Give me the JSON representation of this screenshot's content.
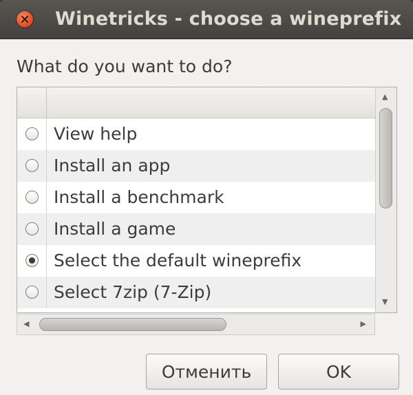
{
  "window": {
    "title": "Winetricks - choose a wineprefix"
  },
  "prompt": "What do you want to do?",
  "options": [
    {
      "label": "View help",
      "selected": false
    },
    {
      "label": "Install an app",
      "selected": false
    },
    {
      "label": "Install a benchmark",
      "selected": false
    },
    {
      "label": "Install a game",
      "selected": false
    },
    {
      "label": "Select the default wineprefix",
      "selected": true
    },
    {
      "label": "Select 7zip (7-Zip)",
      "selected": false
    }
  ],
  "buttons": {
    "cancel_label": "Отменить",
    "ok_label": "OK"
  },
  "icons": {
    "close": "close-icon",
    "scroll_up": "scroll-up-arrow-icon",
    "scroll_down": "scroll-down-arrow-icon",
    "scroll_left": "scroll-left-arrow-icon",
    "scroll_right": "scroll-right-arrow-icon"
  },
  "colors": {
    "titlebar": "#4b4a45",
    "close_button": "#e0512b",
    "window_bg": "#f2f1f0"
  }
}
